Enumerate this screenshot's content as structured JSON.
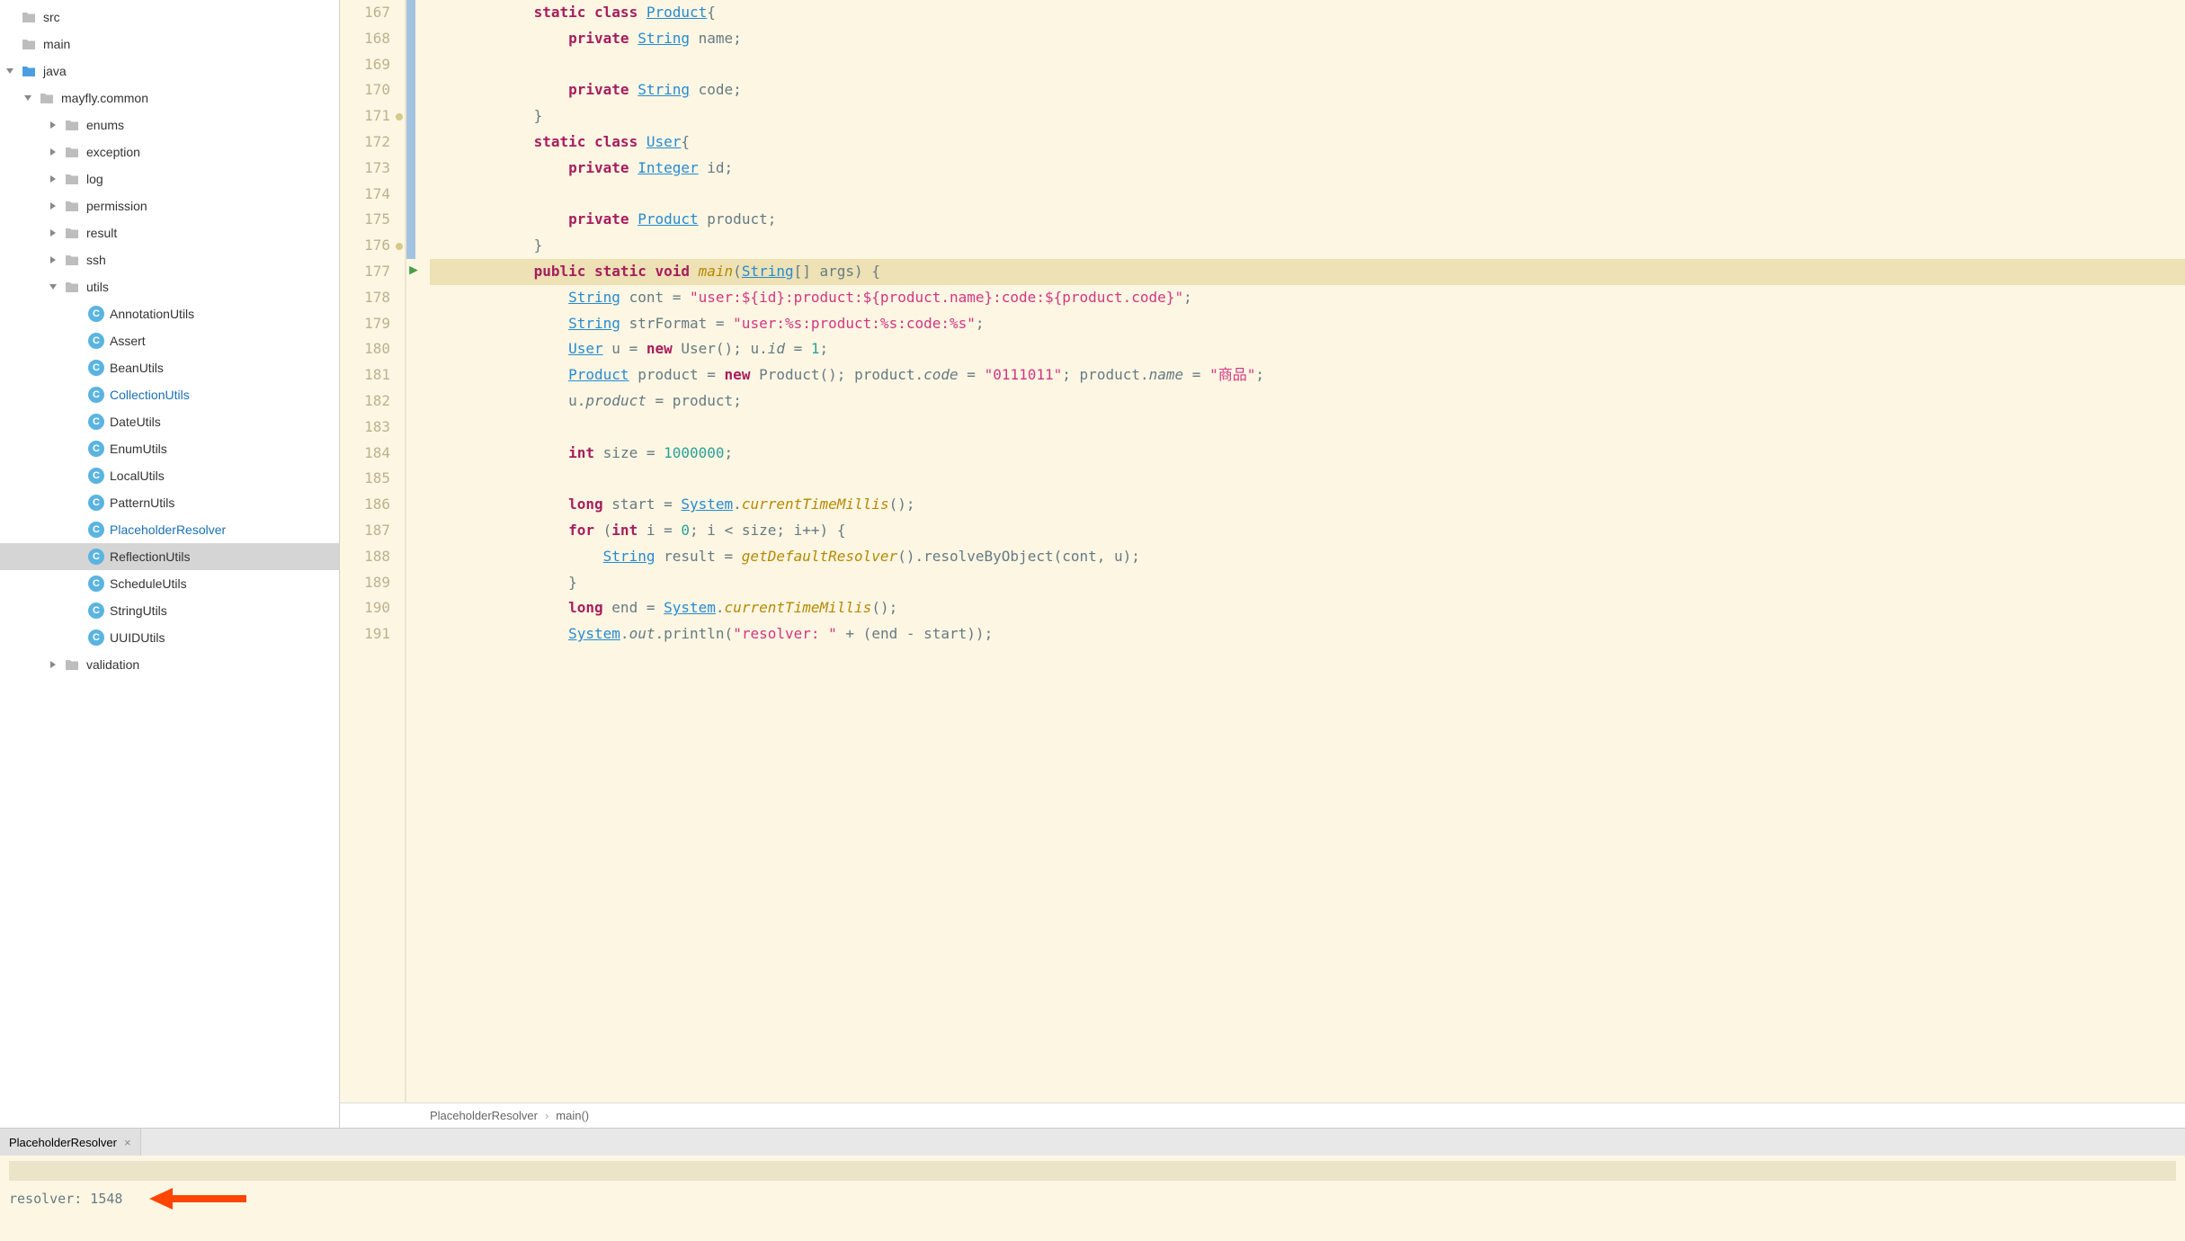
{
  "sidebar": {
    "tree": [
      {
        "indent": 0,
        "chevron": "none",
        "icon": "folder-gray",
        "label": "src",
        "active": false
      },
      {
        "indent": 0,
        "chevron": "none",
        "icon": "folder-gray",
        "label": "main",
        "active": false
      },
      {
        "indent": 0,
        "chevron": "down",
        "icon": "folder-blue",
        "label": "java",
        "active": false
      },
      {
        "indent": 1,
        "chevron": "down",
        "icon": "folder-gray",
        "label": "mayfly.common",
        "active": false
      },
      {
        "indent": 2,
        "chevron": "right",
        "icon": "folder-gray",
        "label": "enums",
        "active": false
      },
      {
        "indent": 2,
        "chevron": "right",
        "icon": "folder-gray",
        "label": "exception",
        "active": false
      },
      {
        "indent": 2,
        "chevron": "right",
        "icon": "folder-gray",
        "label": "log",
        "active": false
      },
      {
        "indent": 2,
        "chevron": "right",
        "icon": "folder-gray",
        "label": "permission",
        "active": false
      },
      {
        "indent": 2,
        "chevron": "right",
        "icon": "folder-gray",
        "label": "result",
        "active": false
      },
      {
        "indent": 2,
        "chevron": "right",
        "icon": "folder-gray",
        "label": "ssh",
        "active": false
      },
      {
        "indent": 2,
        "chevron": "down",
        "icon": "folder-gray",
        "label": "utils",
        "active": false
      },
      {
        "indent": 3,
        "chevron": "none",
        "icon": "class",
        "label": "AnnotationUtils",
        "active": false
      },
      {
        "indent": 3,
        "chevron": "none",
        "icon": "class",
        "label": "Assert",
        "active": false
      },
      {
        "indent": 3,
        "chevron": "none",
        "icon": "class",
        "label": "BeanUtils",
        "active": false
      },
      {
        "indent": 3,
        "chevron": "none",
        "icon": "class",
        "label": "CollectionUtils",
        "active": true
      },
      {
        "indent": 3,
        "chevron": "none",
        "icon": "class",
        "label": "DateUtils",
        "active": false
      },
      {
        "indent": 3,
        "chevron": "none",
        "icon": "class",
        "label": "EnumUtils",
        "active": false
      },
      {
        "indent": 3,
        "chevron": "none",
        "icon": "class",
        "label": "LocalUtils",
        "active": false
      },
      {
        "indent": 3,
        "chevron": "none",
        "icon": "class",
        "label": "PatternUtils",
        "active": false
      },
      {
        "indent": 3,
        "chevron": "none",
        "icon": "class",
        "label": "PlaceholderResolver",
        "active": true
      },
      {
        "indent": 3,
        "chevron": "none",
        "icon": "class",
        "label": "ReflectionUtils",
        "active": false,
        "selected": true
      },
      {
        "indent": 3,
        "chevron": "none",
        "icon": "class",
        "label": "ScheduleUtils",
        "active": false
      },
      {
        "indent": 3,
        "chevron": "none",
        "icon": "class",
        "label": "StringUtils",
        "active": false
      },
      {
        "indent": 3,
        "chevron": "none",
        "icon": "class",
        "label": "UUIDUtils",
        "active": false
      },
      {
        "indent": 2,
        "chevron": "right",
        "icon": "folder-gray",
        "label": "validation",
        "active": false
      }
    ]
  },
  "editor": {
    "lines": [
      {
        "num": 167,
        "blue": true,
        "indent": 12,
        "tokens": [
          [
            "kw",
            "static"
          ],
          [
            "punct",
            " "
          ],
          [
            "kw",
            "class"
          ],
          [
            "punct",
            " "
          ],
          [
            "type",
            "Product"
          ],
          [
            "punct",
            "{"
          ]
        ]
      },
      {
        "num": 168,
        "blue": true,
        "indent": 16,
        "tokens": [
          [
            "kw",
            "private"
          ],
          [
            "punct",
            " "
          ],
          [
            "type",
            "String"
          ],
          [
            "punct",
            " "
          ],
          [
            "ident",
            "name"
          ],
          [
            "punct",
            ";"
          ]
        ]
      },
      {
        "num": 169,
        "blue": true,
        "indent": 0,
        "tokens": []
      },
      {
        "num": 170,
        "blue": true,
        "indent": 16,
        "tokens": [
          [
            "kw",
            "private"
          ],
          [
            "punct",
            " "
          ],
          [
            "type",
            "String"
          ],
          [
            "punct",
            " "
          ],
          [
            "ident",
            "code"
          ],
          [
            "punct",
            ";"
          ]
        ]
      },
      {
        "num": 171,
        "blue": true,
        "marker": true,
        "indent": 12,
        "tokens": [
          [
            "punct",
            "}"
          ]
        ]
      },
      {
        "num": 172,
        "blue": true,
        "indent": 12,
        "tokens": [
          [
            "kw",
            "static"
          ],
          [
            "punct",
            " "
          ],
          [
            "kw",
            "class"
          ],
          [
            "punct",
            " "
          ],
          [
            "type",
            "User"
          ],
          [
            "punct",
            "{"
          ]
        ]
      },
      {
        "num": 173,
        "blue": true,
        "indent": 16,
        "tokens": [
          [
            "kw",
            "private"
          ],
          [
            "punct",
            " "
          ],
          [
            "type",
            "Integer"
          ],
          [
            "punct",
            " "
          ],
          [
            "ident",
            "id"
          ],
          [
            "punct",
            ";"
          ]
        ]
      },
      {
        "num": 174,
        "blue": true,
        "indent": 0,
        "tokens": []
      },
      {
        "num": 175,
        "blue": true,
        "indent": 16,
        "tokens": [
          [
            "kw",
            "private"
          ],
          [
            "punct",
            " "
          ],
          [
            "type",
            "Product"
          ],
          [
            "punct",
            " "
          ],
          [
            "ident",
            "product"
          ],
          [
            "punct",
            ";"
          ]
        ]
      },
      {
        "num": 176,
        "blue": true,
        "marker": true,
        "indent": 12,
        "tokens": [
          [
            "punct",
            "}"
          ]
        ]
      },
      {
        "num": 177,
        "blue": false,
        "run": true,
        "highlighted": true,
        "indent": 12,
        "tokens": [
          [
            "kw",
            "public"
          ],
          [
            "punct",
            " "
          ],
          [
            "kw",
            "static"
          ],
          [
            "punct",
            " "
          ],
          [
            "kw",
            "void"
          ],
          [
            "punct",
            " "
          ],
          [
            "method",
            "main"
          ],
          [
            "punct",
            "("
          ],
          [
            "type",
            "String"
          ],
          [
            "punct",
            "[] "
          ],
          [
            "ident",
            "args"
          ],
          [
            "punct",
            ") {"
          ]
        ]
      },
      {
        "num": 178,
        "blue": false,
        "indent": 16,
        "tokens": [
          [
            "type",
            "String"
          ],
          [
            "punct",
            " "
          ],
          [
            "ident",
            "cont"
          ],
          [
            "punct",
            " = "
          ],
          [
            "str",
            "\"user:${id}:product:${product.name}:code:${product.code}\""
          ],
          [
            "punct",
            ";"
          ]
        ]
      },
      {
        "num": 179,
        "blue": false,
        "indent": 16,
        "tokens": [
          [
            "type",
            "String"
          ],
          [
            "punct",
            " "
          ],
          [
            "ident",
            "strFormat"
          ],
          [
            "punct",
            " = "
          ],
          [
            "str",
            "\"user:%s:product:%s:code:%s\""
          ],
          [
            "punct",
            ";"
          ]
        ]
      },
      {
        "num": 180,
        "blue": false,
        "indent": 16,
        "tokens": [
          [
            "type",
            "User"
          ],
          [
            "punct",
            " "
          ],
          [
            "ident",
            "u"
          ],
          [
            "punct",
            " = "
          ],
          [
            "kw",
            "new"
          ],
          [
            "punct",
            " "
          ],
          [
            "ident",
            "User"
          ],
          [
            "punct",
            "(); "
          ],
          [
            "ident",
            "u"
          ],
          [
            "punct",
            "."
          ],
          [
            "field",
            "id"
          ],
          [
            "punct",
            " = "
          ],
          [
            "num",
            "1"
          ],
          [
            "punct",
            ";"
          ]
        ]
      },
      {
        "num": 181,
        "blue": false,
        "indent": 16,
        "tokens": [
          [
            "type",
            "Product"
          ],
          [
            "punct",
            " "
          ],
          [
            "ident",
            "product"
          ],
          [
            "punct",
            " = "
          ],
          [
            "kw",
            "new"
          ],
          [
            "punct",
            " "
          ],
          [
            "ident",
            "Product"
          ],
          [
            "punct",
            "(); "
          ],
          [
            "ident",
            "product"
          ],
          [
            "punct",
            "."
          ],
          [
            "field",
            "code"
          ],
          [
            "punct",
            " = "
          ],
          [
            "str",
            "\"0111011\""
          ],
          [
            "punct",
            "; "
          ],
          [
            "ident",
            "product"
          ],
          [
            "punct",
            "."
          ],
          [
            "field",
            "name"
          ],
          [
            "punct",
            " = "
          ],
          [
            "str",
            "\"商品\""
          ],
          [
            "punct",
            ";"
          ]
        ]
      },
      {
        "num": 182,
        "blue": false,
        "indent": 16,
        "tokens": [
          [
            "ident",
            "u"
          ],
          [
            "punct",
            "."
          ],
          [
            "field",
            "product"
          ],
          [
            "punct",
            " = "
          ],
          [
            "ident",
            "product"
          ],
          [
            "punct",
            ";"
          ]
        ]
      },
      {
        "num": 183,
        "blue": false,
        "indent": 0,
        "tokens": []
      },
      {
        "num": 184,
        "blue": false,
        "indent": 16,
        "tokens": [
          [
            "kw",
            "int"
          ],
          [
            "punct",
            " "
          ],
          [
            "ident",
            "size"
          ],
          [
            "punct",
            " = "
          ],
          [
            "num",
            "1000000"
          ],
          [
            "punct",
            ";"
          ]
        ]
      },
      {
        "num": 185,
        "blue": false,
        "indent": 0,
        "tokens": []
      },
      {
        "num": 186,
        "blue": false,
        "indent": 16,
        "tokens": [
          [
            "kw",
            "long"
          ],
          [
            "punct",
            " "
          ],
          [
            "ident",
            "start"
          ],
          [
            "punct",
            " = "
          ],
          [
            "type",
            "System"
          ],
          [
            "punct",
            "."
          ],
          [
            "method",
            "currentTimeMillis"
          ],
          [
            "punct",
            "();"
          ]
        ]
      },
      {
        "num": 187,
        "blue": false,
        "indent": 16,
        "tokens": [
          [
            "kw",
            "for"
          ],
          [
            "punct",
            " ("
          ],
          [
            "kw",
            "int"
          ],
          [
            "punct",
            " "
          ],
          [
            "ident",
            "i"
          ],
          [
            "punct",
            " = "
          ],
          [
            "num",
            "0"
          ],
          [
            "punct",
            "; "
          ],
          [
            "ident",
            "i"
          ],
          [
            "punct",
            " < "
          ],
          [
            "ident",
            "size"
          ],
          [
            "punct",
            "; "
          ],
          [
            "ident",
            "i"
          ],
          [
            "punct",
            "++) {"
          ]
        ]
      },
      {
        "num": 188,
        "blue": false,
        "indent": 20,
        "tokens": [
          [
            "type",
            "String"
          ],
          [
            "punct",
            " "
          ],
          [
            "ident",
            "result"
          ],
          [
            "punct",
            " = "
          ],
          [
            "method",
            "getDefaultResolver"
          ],
          [
            "punct",
            "()."
          ],
          [
            "ident",
            "resolveByObject"
          ],
          [
            "punct",
            "("
          ],
          [
            "ident",
            "cont"
          ],
          [
            "punct",
            ", "
          ],
          [
            "ident",
            "u"
          ],
          [
            "punct",
            ");"
          ]
        ]
      },
      {
        "num": 189,
        "blue": false,
        "indent": 16,
        "tokens": [
          [
            "punct",
            "}"
          ]
        ]
      },
      {
        "num": 190,
        "blue": false,
        "indent": 16,
        "tokens": [
          [
            "kw",
            "long"
          ],
          [
            "punct",
            " "
          ],
          [
            "ident",
            "end"
          ],
          [
            "punct",
            " = "
          ],
          [
            "type",
            "System"
          ],
          [
            "punct",
            "."
          ],
          [
            "method",
            "currentTimeMillis"
          ],
          [
            "punct",
            "();"
          ]
        ]
      },
      {
        "num": 191,
        "blue": false,
        "indent": 16,
        "tokens": [
          [
            "type",
            "System"
          ],
          [
            "punct",
            "."
          ],
          [
            "static-field",
            "out"
          ],
          [
            "punct",
            "."
          ],
          [
            "ident",
            "println"
          ],
          [
            "punct",
            "("
          ],
          [
            "str",
            "\"resolver: \""
          ],
          [
            "punct",
            " + ("
          ],
          [
            "ident",
            "end"
          ],
          [
            "punct",
            " - "
          ],
          [
            "ident",
            "start"
          ],
          [
            "punct",
            "));"
          ]
        ]
      }
    ]
  },
  "breadcrumb": {
    "items": [
      "PlaceholderResolver",
      "main()"
    ]
  },
  "console": {
    "tab_label": "PlaceholderResolver",
    "output": "resolver: 1548"
  }
}
